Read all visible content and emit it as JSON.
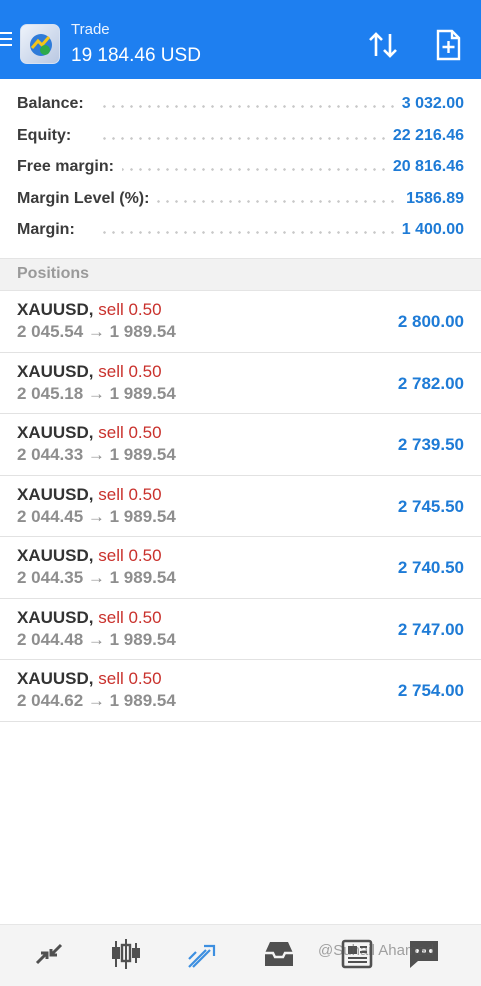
{
  "header": {
    "title": "Trade",
    "balance_display": "19 184.46 USD",
    "menu_icon": "menu-icon",
    "sort_icon": "sort-arrows-icon",
    "new_order_icon": "new-order-icon",
    "color": "#1e7ff0"
  },
  "summary": {
    "balance": {
      "label": "Balance:",
      "value": "3 032.00"
    },
    "equity": {
      "label": "Equity:",
      "value": "22 216.46"
    },
    "free_margin": {
      "label": "Free margin:",
      "value": "20 816.46"
    },
    "margin_level": {
      "label": "Margin Level (%):",
      "value": "1586.89"
    },
    "margin": {
      "label": "Margin:",
      "value": "1 400.00"
    }
  },
  "positions": {
    "title": "Positions",
    "items": [
      {
        "symbol": "XAUUSD,",
        "side": "sell 0.50",
        "prices": "2 045.54 → 1 989.54",
        "profit": "2 800.00"
      },
      {
        "symbol": "XAUUSD,",
        "side": "sell 0.50",
        "prices": "2 045.18 → 1 989.54",
        "profit": "2 782.00"
      },
      {
        "symbol": "XAUUSD,",
        "side": "sell 0.50",
        "prices": "2 044.33 → 1 989.54",
        "profit": "2 739.50"
      },
      {
        "symbol": "XAUUSD,",
        "side": "sell 0.50",
        "prices": "2 044.45 → 1 989.54",
        "profit": "2 745.50"
      },
      {
        "symbol": "XAUUSD,",
        "side": "sell 0.50",
        "prices": "2 044.35 → 1 989.54",
        "profit": "2 740.50"
      },
      {
        "symbol": "XAUUSD,",
        "side": "sell 0.50",
        "prices": "2 044.48 → 1 989.54",
        "profit": "2 747.00"
      },
      {
        "symbol": "XAUUSD,",
        "side": "sell 0.50",
        "prices": "2 044.62 → 1 989.54",
        "profit": "2 754.00"
      }
    ]
  },
  "bottom_nav": {
    "items": [
      "quotes-icon",
      "chart-icon",
      "trade-icon",
      "history-icon",
      "news-icon",
      "messages-icon"
    ],
    "active": "trade-icon"
  },
  "watermark": "@Suhail Ahamad",
  "colors": {
    "accent": "#1e7bd6",
    "sell": "#c9312c",
    "muted": "#8e8e8e"
  }
}
